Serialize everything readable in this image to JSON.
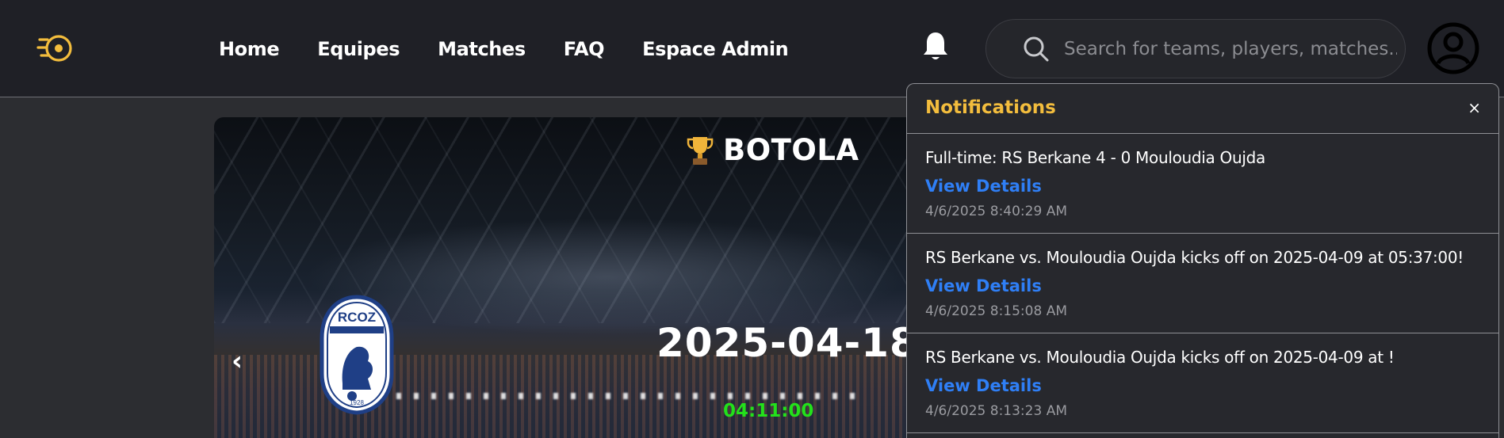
{
  "nav": {
    "items": [
      {
        "label": "Home"
      },
      {
        "label": "Equipes"
      },
      {
        "label": "Matches"
      },
      {
        "label": "FAQ"
      },
      {
        "label": "Espace Admin"
      }
    ]
  },
  "search": {
    "placeholder": "Search for teams, players, matches..."
  },
  "icons": {
    "logo": "football-logo-icon",
    "bell": "bell-icon",
    "search": "search-icon",
    "user": "user-avatar-icon",
    "trophy": "trophy-icon",
    "prev": "chevron-left-icon"
  },
  "hero": {
    "league": "BOTOLA",
    "prev_arrow": "‹",
    "date": "2025-04-18",
    "time": "04:11:00",
    "crest_text": "RCOZ",
    "crest_year": "1928"
  },
  "notifications": {
    "title": "Notifications",
    "close_label": "×",
    "items": [
      {
        "message": "Full-time: RS Berkane 4 - 0 Mouloudia Oujda",
        "link": "View Details",
        "time": "4/6/2025 8:40:29 AM"
      },
      {
        "message": "RS Berkane vs. Mouloudia Oujda kicks off on 2025-04-09 at 05:37:00!",
        "link": "View Details",
        "time": "4/6/2025 8:15:08 AM"
      },
      {
        "message": "RS Berkane vs. Mouloudia Oujda kicks off on 2025-04-09 at !",
        "link": "View Details",
        "time": "4/6/2025 8:13:23 AM"
      }
    ]
  },
  "colors": {
    "header_bg": "#1f2026",
    "page_bg": "#2c2d31",
    "accent": "#f3bd3d",
    "link": "#2f7ff6",
    "time_green": "#23e01b"
  }
}
